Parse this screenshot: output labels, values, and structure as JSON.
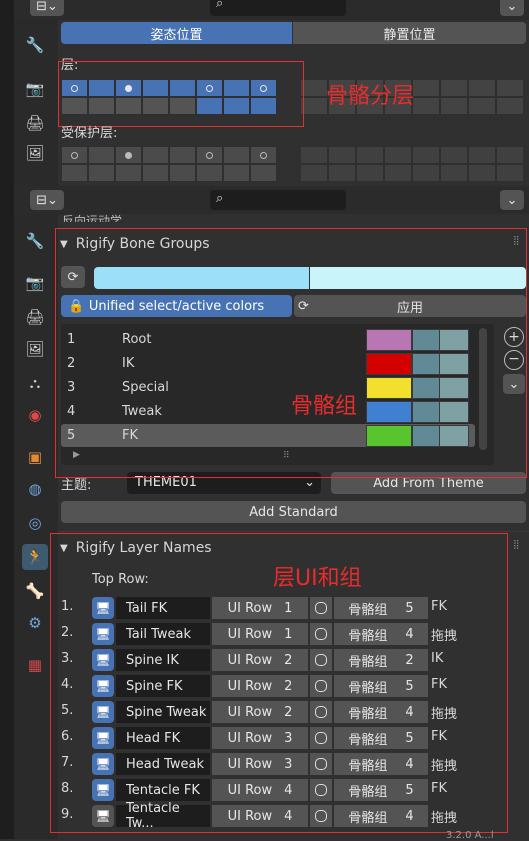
{
  "top_section": {
    "tabs": [
      "姿态位置",
      "静置位置"
    ],
    "layers_label": "层:",
    "protected_label": "受保护层:"
  },
  "annotations": {
    "layers": "骨骼分层",
    "bone_groups": "骨骼组",
    "layer_names": "层UI和组"
  },
  "partial_text": "反向运动学",
  "bone_groups_panel": {
    "title": "Rigify Bone Groups",
    "unified_label": "Unified select/active colors",
    "apply_label": "应用",
    "groups": [
      {
        "num": "1",
        "name": "Root",
        "color": "#b877b2"
      },
      {
        "num": "2",
        "name": "IK",
        "color": "#d40000"
      },
      {
        "num": "3",
        "name": "Special",
        "color": "#f2e02c"
      },
      {
        "num": "4",
        "name": "Tweak",
        "color": "#3f80d0"
      },
      {
        "num": "5",
        "name": "FK",
        "color": "#58c52f"
      }
    ],
    "theme_label": "主题:",
    "theme_value": "THEME01",
    "add_from_theme": "Add From Theme",
    "add_standard": "Add Standard",
    "colors": {
      "select": "#5f8a96",
      "active": "#7fa1a3",
      "bar_left": "#9be0f8",
      "bar_right": "#c8f4fa"
    }
  },
  "layer_names_panel": {
    "title": "Rigify Layer Names",
    "top_row_label": "Top Row:",
    "rows": [
      {
        "num": "1.",
        "name": "Tail FK",
        "ui_row": "UI Row",
        "row_val": "1",
        "group_label": "骨骼组",
        "group_val": "5",
        "group_name": "FK"
      },
      {
        "num": "2.",
        "name": "Tail Tweak",
        "ui_row": "UI Row",
        "row_val": "1",
        "group_label": "骨骼组",
        "group_val": "4",
        "group_name": "拖拽"
      },
      {
        "num": "3.",
        "name": "Spine IK",
        "ui_row": "UI Row",
        "row_val": "2",
        "group_label": "骨骼组",
        "group_val": "2",
        "group_name": "IK"
      },
      {
        "num": "4.",
        "name": "Spine FK",
        "ui_row": "UI Row",
        "row_val": "2",
        "group_label": "骨骼组",
        "group_val": "5",
        "group_name": "FK"
      },
      {
        "num": "5.",
        "name": "Spine Tweak",
        "ui_row": "UI Row",
        "row_val": "2",
        "group_label": "骨骼组",
        "group_val": "4",
        "group_name": "拖拽"
      },
      {
        "num": "6.",
        "name": "Head FK",
        "ui_row": "UI Row",
        "row_val": "3",
        "group_label": "骨骼组",
        "group_val": "5",
        "group_name": "FK"
      },
      {
        "num": "7.",
        "name": "Head Tweak",
        "ui_row": "UI Row",
        "row_val": "3",
        "group_label": "骨骼组",
        "group_val": "4",
        "group_name": "拖拽"
      },
      {
        "num": "8.",
        "name": "Tentacle FK",
        "ui_row": "UI Row",
        "row_val": "4",
        "group_label": "骨骼组",
        "group_val": "5",
        "group_name": "FK"
      },
      {
        "num": "9.",
        "name": "Tentacle Tw...",
        "ui_row": "UI Row",
        "row_val": "4",
        "group_label": "骨骼组",
        "group_val": "4",
        "group_name": "拖拽"
      }
    ]
  },
  "version_text": "3.2.0 A...l"
}
